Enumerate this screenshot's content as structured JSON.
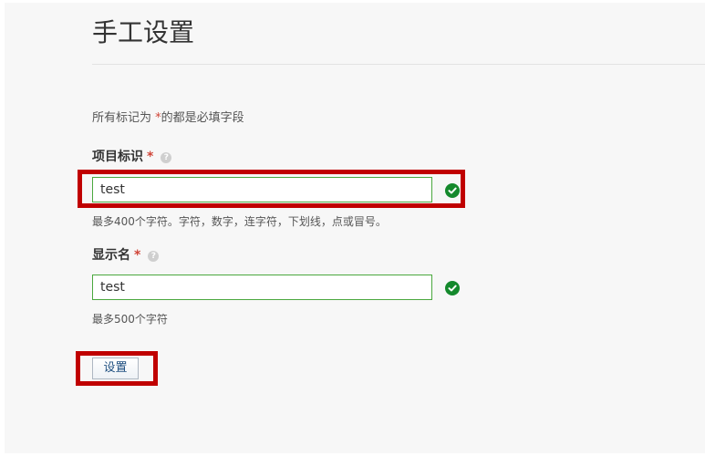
{
  "page": {
    "title": "手工设置"
  },
  "form": {
    "required_note_prefix": "所有标记为 ",
    "required_marker": "*",
    "required_note_suffix": "的都是必填字段",
    "project_key": {
      "label": "项目标识",
      "required_marker": "*",
      "help_icon": "question-circle-icon",
      "value": "test",
      "status_icon": "check-circle-icon",
      "hint": "最多400个字符。字符，数字，连字符，下划线，点或冒号。"
    },
    "display_name": {
      "label": "显示名",
      "required_marker": "*",
      "help_icon": "question-circle-icon",
      "value": "test",
      "status_icon": "check-circle-icon",
      "hint": "最多500个字符"
    },
    "submit_label": "设置"
  },
  "colors": {
    "valid_border": "#4aa83e",
    "success_icon": "#14892c",
    "required_star": "#d04437",
    "annotation_red": "#c00000",
    "button_text": "#205081"
  }
}
